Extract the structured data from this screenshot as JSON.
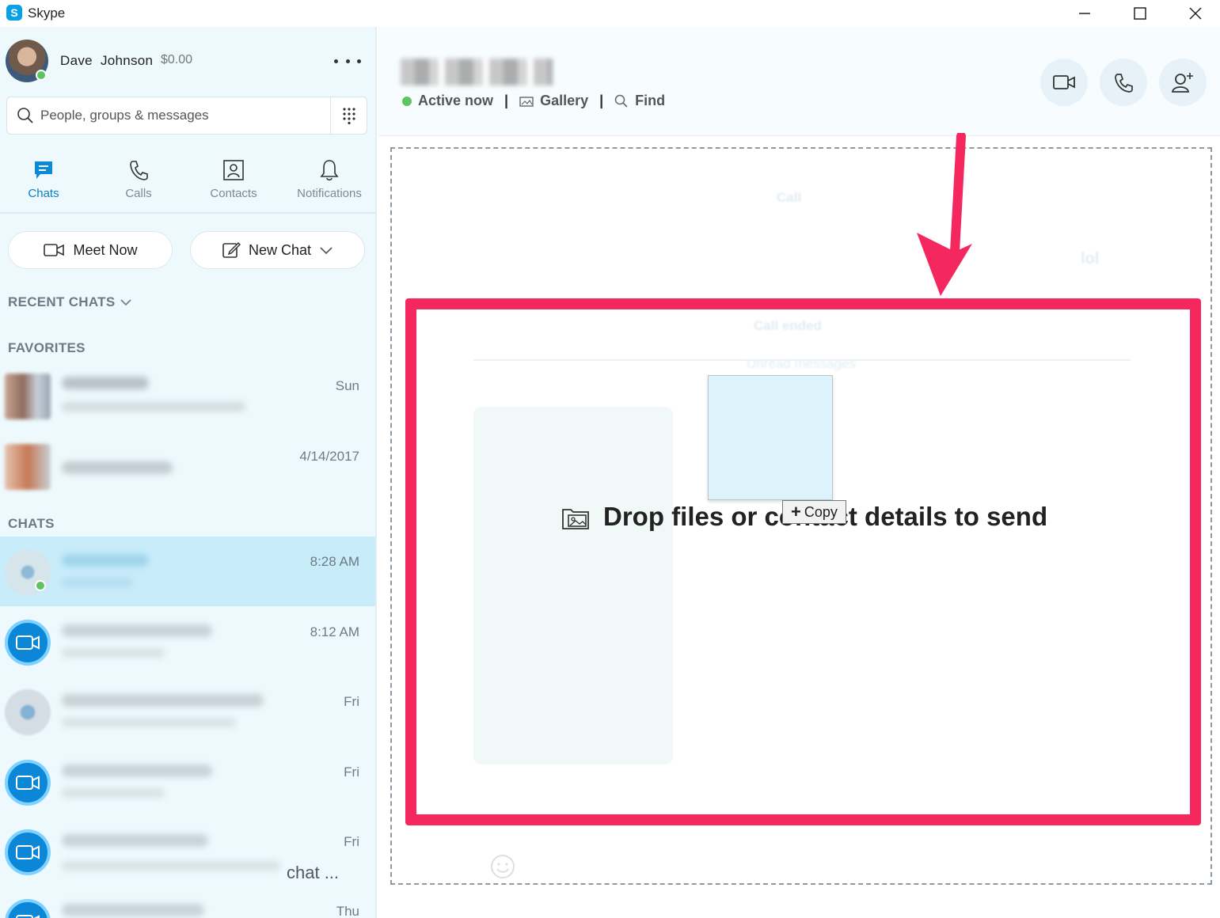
{
  "window": {
    "title": "Skype",
    "controls": {
      "minimize": "—",
      "maximize": "☐",
      "close": "✕"
    }
  },
  "profile": {
    "first_name": "Dave",
    "last_name": "Johnson",
    "credit": "$0.00",
    "status": "online"
  },
  "search": {
    "placeholder": "People, groups & messages"
  },
  "nav": {
    "tabs": [
      {
        "label": "Chats",
        "icon": "chat-icon",
        "active": true
      },
      {
        "label": "Calls",
        "icon": "phone-icon"
      },
      {
        "label": "Contacts",
        "icon": "contacts-icon"
      },
      {
        "label": "Notifications",
        "icon": "bell-icon"
      }
    ]
  },
  "actions": {
    "meet_now": "Meet Now",
    "new_chat": "New Chat"
  },
  "sections": {
    "recent": "RECENT CHATS",
    "favorites": "FAVORITES",
    "chats": "CHATS"
  },
  "favorites": [
    {
      "time": "Sun"
    },
    {
      "time": "4/14/2017"
    }
  ],
  "chats": [
    {
      "time": "8:28 AM",
      "selected": true,
      "avatar": "image"
    },
    {
      "time": "8:12 AM",
      "avatar": "video-call-icon"
    },
    {
      "time": "Fri",
      "avatar": "image"
    },
    {
      "time": "Fri",
      "avatar": "video-call-icon"
    },
    {
      "time": "Fri",
      "avatar": "video-call-icon",
      "preview_tail": "chat ..."
    },
    {
      "time": "Thu",
      "avatar": "video-call-icon"
    }
  ],
  "conversation": {
    "status": "Active now",
    "gallery": "Gallery",
    "find": "Find",
    "separator": "|"
  },
  "ghost_messages": {
    "call": "Call",
    "call_ended": "Call ended",
    "unread": "Unread messages",
    "reply": "lol"
  },
  "drop": {
    "message": "Drop files or contact details to send",
    "tooltip": "Copy",
    "tooltip_prefix": "+"
  },
  "colors": {
    "accent": "#0c7fc0",
    "highlight": "#f4285f",
    "presence": "#5ec45e",
    "sidebar_bg": "#edf9fd"
  }
}
